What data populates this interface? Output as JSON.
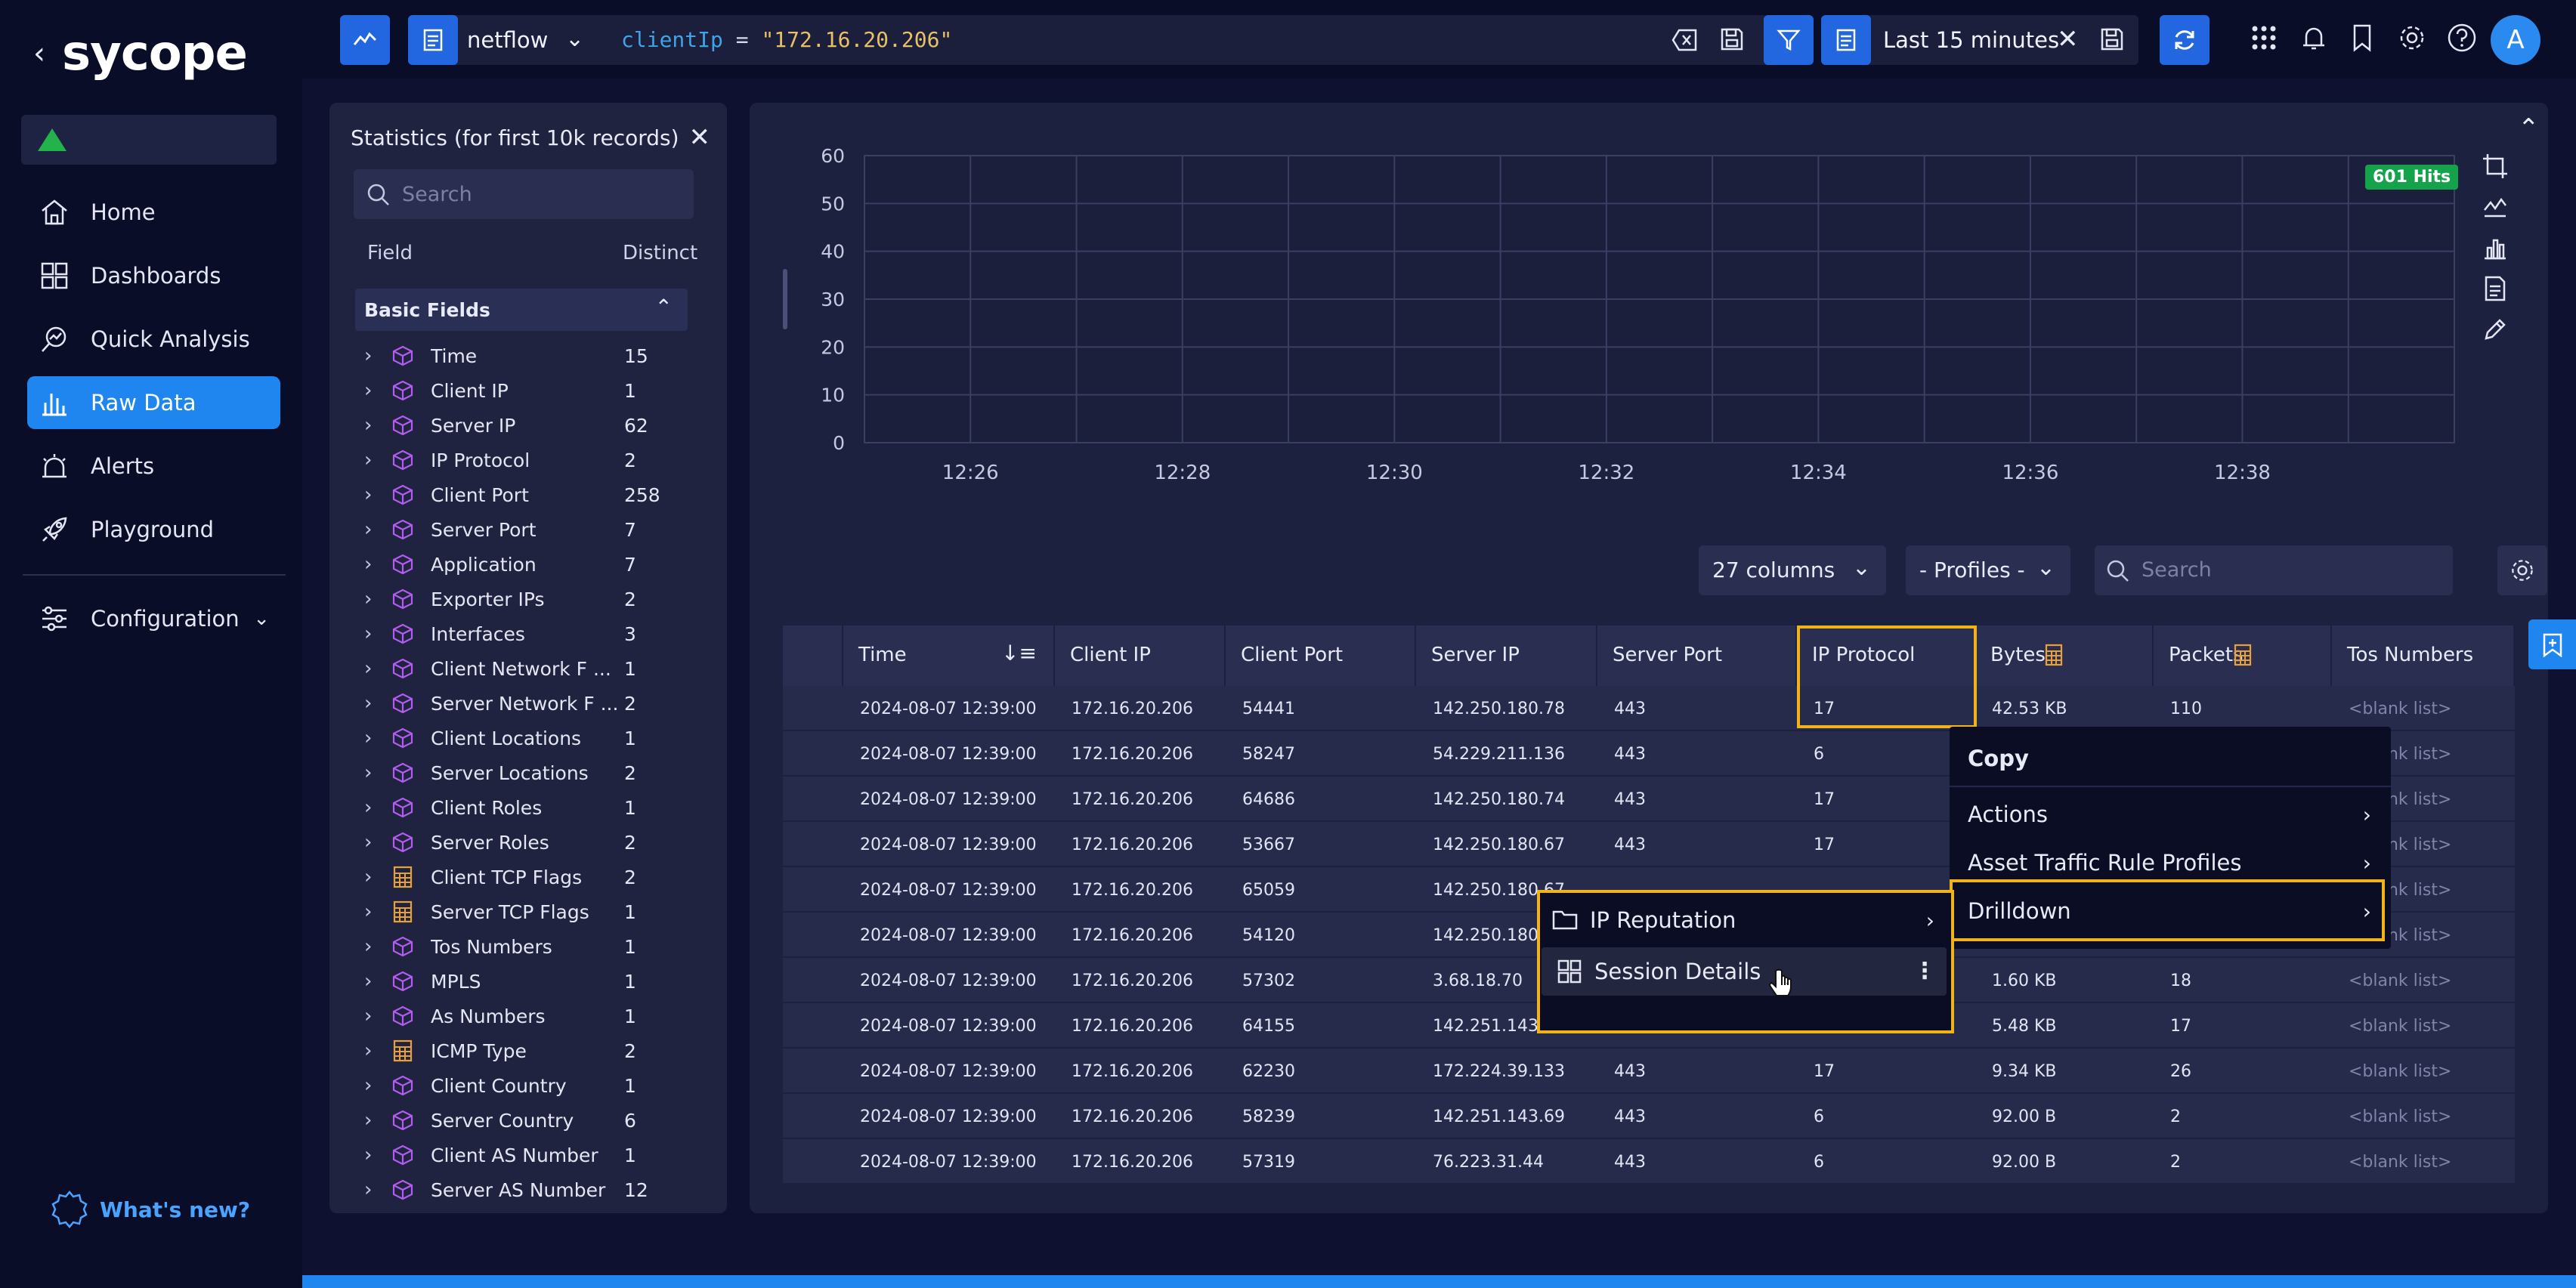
{
  "app": {
    "logo_text": "sycope",
    "whats_new": "What's new?"
  },
  "nav": {
    "items": [
      {
        "label": "Home",
        "icon": "home-icon"
      },
      {
        "label": "Dashboards",
        "icon": "dashboards-icon"
      },
      {
        "label": "Quick Analysis",
        "icon": "quick-analysis-icon"
      },
      {
        "label": "Raw Data",
        "icon": "raw-data-icon",
        "active": true
      },
      {
        "label": "Alerts",
        "icon": "alarm-icon"
      },
      {
        "label": "Playground",
        "icon": "rocket-icon"
      }
    ],
    "configuration": "Configuration"
  },
  "query": {
    "source": "netflow",
    "field": "clientIp",
    "operator": "=",
    "value": "\"172.16.20.206\""
  },
  "time_range": {
    "label": "Last 15 minutes"
  },
  "user": {
    "initial": "A"
  },
  "stats": {
    "title": "Statistics (for first 10k records)",
    "search_placeholder": "Search",
    "col_field": "Field",
    "col_distinct": "Distinct",
    "section": "Basic Fields",
    "fields": [
      {
        "name": "Time",
        "count": "15",
        "icon": "cube-icon"
      },
      {
        "name": "Client IP",
        "count": "1",
        "icon": "cube-icon"
      },
      {
        "name": "Server IP",
        "count": "62",
        "icon": "cube-icon"
      },
      {
        "name": "IP Protocol",
        "count": "2",
        "icon": "cube-icon"
      },
      {
        "name": "Client Port",
        "count": "258",
        "icon": "cube-icon"
      },
      {
        "name": "Server Port",
        "count": "7",
        "icon": "cube-icon"
      },
      {
        "name": "Application",
        "count": "7",
        "icon": "cube-icon"
      },
      {
        "name": "Exporter IPs",
        "count": "2",
        "icon": "cube-icon"
      },
      {
        "name": "Interfaces",
        "count": "3",
        "icon": "cube-icon"
      },
      {
        "name": "Client Network F ...",
        "count": "1",
        "icon": "cube-icon"
      },
      {
        "name": "Server Network F ...",
        "count": "2",
        "icon": "cube-icon"
      },
      {
        "name": "Client Locations",
        "count": "1",
        "icon": "cube-icon"
      },
      {
        "name": "Server Locations",
        "count": "2",
        "icon": "cube-icon"
      },
      {
        "name": "Client Roles",
        "count": "1",
        "icon": "cube-icon"
      },
      {
        "name": "Server Roles",
        "count": "2",
        "icon": "cube-icon"
      },
      {
        "name": "Client TCP Flags",
        "count": "2",
        "icon": "calculator-icon"
      },
      {
        "name": "Server TCP Flags",
        "count": "1",
        "icon": "calculator-icon"
      },
      {
        "name": "Tos Numbers",
        "count": "1",
        "icon": "cube-icon"
      },
      {
        "name": "MPLS",
        "count": "1",
        "icon": "cube-icon"
      },
      {
        "name": "As Numbers",
        "count": "1",
        "icon": "cube-icon"
      },
      {
        "name": "ICMP Type",
        "count": "2",
        "icon": "calculator-icon"
      },
      {
        "name": "Client Country",
        "count": "1",
        "icon": "cube-icon"
      },
      {
        "name": "Server Country",
        "count": "6",
        "icon": "cube-icon"
      },
      {
        "name": "Client AS Number",
        "count": "1",
        "icon": "cube-icon"
      },
      {
        "name": "Server AS Number",
        "count": "12",
        "icon": "cube-icon"
      }
    ]
  },
  "chart_data": {
    "type": "bar",
    "title": "",
    "x_ticks": [
      "12:26",
      "12:28",
      "12:30",
      "12:32",
      "12:34",
      "12:36",
      "12:38"
    ],
    "y_ticks": [
      0,
      10,
      20,
      30,
      40,
      50,
      60
    ],
    "ylim": [
      0,
      60
    ],
    "grid": true,
    "badge": "601 Hits"
  },
  "table_controls": {
    "columns": "27 columns",
    "profiles": "- Profiles -",
    "search_placeholder": "Search"
  },
  "table": {
    "headers": [
      "",
      "Time",
      "Client IP",
      "Client Port",
      "Server IP",
      "Server Port",
      "IP Protocol",
      "Bytes",
      "Packets",
      "Tos Numbers"
    ],
    "rows": [
      [
        "2024-08-07 12:39:00",
        "172.16.20.206",
        "54441",
        "142.250.180.78",
        "443",
        "17",
        "42.53 KB",
        "110",
        "<blank list>"
      ],
      [
        "2024-08-07 12:39:00",
        "172.16.20.206",
        "58247",
        "54.229.211.136",
        "443",
        "6",
        "",
        "",
        "<blank list>"
      ],
      [
        "2024-08-07 12:39:00",
        "172.16.20.206",
        "64686",
        "142.250.180.74",
        "443",
        "17",
        "",
        "",
        "<blank list>"
      ],
      [
        "2024-08-07 12:39:00",
        "172.16.20.206",
        "53667",
        "142.250.180.67",
        "443",
        "17",
        "",
        "",
        "<blank list>"
      ],
      [
        "2024-08-07 12:39:00",
        "172.16.20.206",
        "65059",
        "142.250.180.67",
        "",
        "",
        "",
        "",
        "<blank list>"
      ],
      [
        "2024-08-07 12:39:00",
        "172.16.20.206",
        "54120",
        "142.250.180.67",
        "",
        "",
        "",
        "",
        "<blank list>"
      ],
      [
        "2024-08-07 12:39:00",
        "172.16.20.206",
        "57302",
        "3.68.18.70",
        "",
        "",
        "1.60 KB",
        "18",
        "<blank list>"
      ],
      [
        "2024-08-07 12:39:00",
        "172.16.20.206",
        "64155",
        "142.251.143.35",
        "",
        "",
        "5.48 KB",
        "17",
        "<blank list>"
      ],
      [
        "2024-08-07 12:39:00",
        "172.16.20.206",
        "62230",
        "172.224.39.133",
        "443",
        "17",
        "9.34 KB",
        "26",
        "<blank list>"
      ],
      [
        "2024-08-07 12:39:00",
        "172.16.20.206",
        "58239",
        "142.251.143.69",
        "443",
        "6",
        "92.00 B",
        "2",
        "<blank list>"
      ],
      [
        "2024-08-07 12:39:00",
        "172.16.20.206",
        "57319",
        "76.223.31.44",
        "443",
        "6",
        "92.00 B",
        "2",
        "<blank list>"
      ]
    ]
  },
  "context_menu": {
    "items": [
      "Copy",
      "Actions",
      "Asset Traffic Rule Profiles",
      "Drilldown"
    ]
  },
  "submenu": {
    "items": [
      "IP Reputation",
      "Session Details"
    ]
  },
  "colors": {
    "accent": "#1f86f0",
    "highlight": "#f2b318",
    "hits_badge": "#14a24a",
    "status_ok": "#22b34a"
  }
}
